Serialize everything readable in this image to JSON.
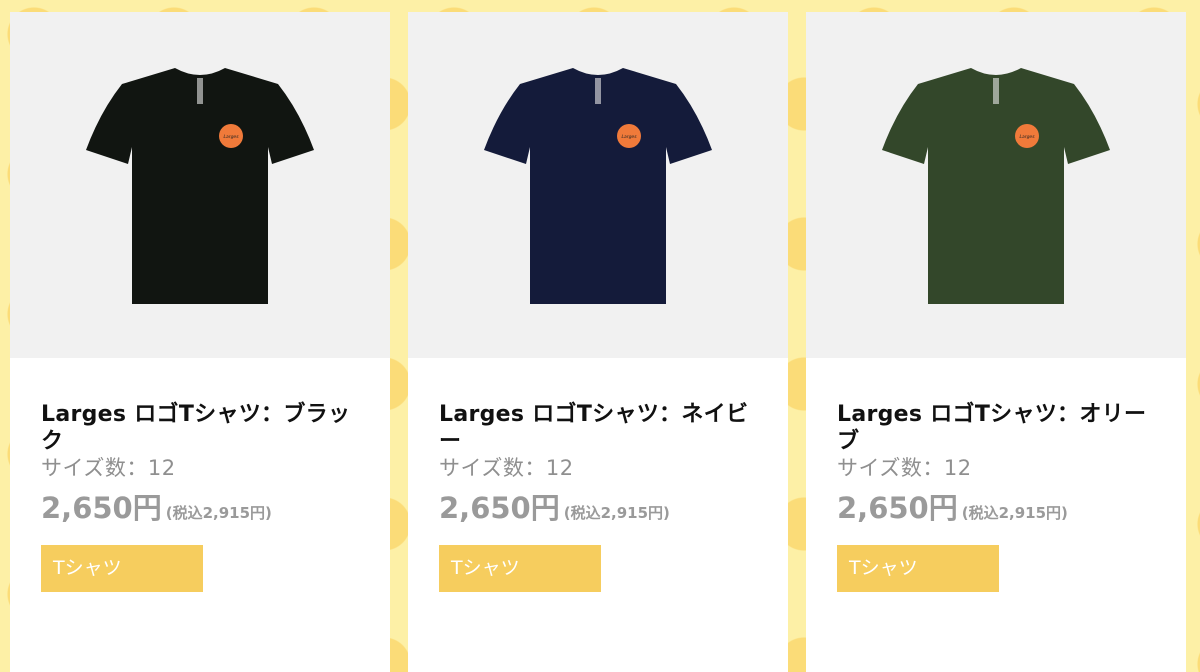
{
  "products": [
    {
      "title": "Larges ロゴTシャツ：ブラック",
      "sizes": "サイズ数：12",
      "price": "2,650円",
      "price_tax": "(税込2,915円)",
      "category": "Tシャツ",
      "shirt_color": "#111511",
      "logo_text": "Larges"
    },
    {
      "title": "Larges ロゴTシャツ：ネイビー",
      "sizes": "サイズ数：12",
      "price": "2,650円",
      "price_tax": "(税込2,915円)",
      "category": "Tシャツ",
      "shirt_color": "#141b3a",
      "logo_text": "Larges"
    },
    {
      "title": "Larges ロゴTシャツ：オリーブ",
      "sizes": "サイズ数：12",
      "price": "2,650円",
      "price_tax": "(税込2,915円)",
      "category": "Tシャツ",
      "shirt_color": "#33472a",
      "logo_text": "Larges"
    }
  ],
  "colors": {
    "background": "#fdf0a6",
    "dots": "#fbdc78",
    "category_button": "#f6cd5e",
    "logo_badge": "#f07a3a"
  }
}
